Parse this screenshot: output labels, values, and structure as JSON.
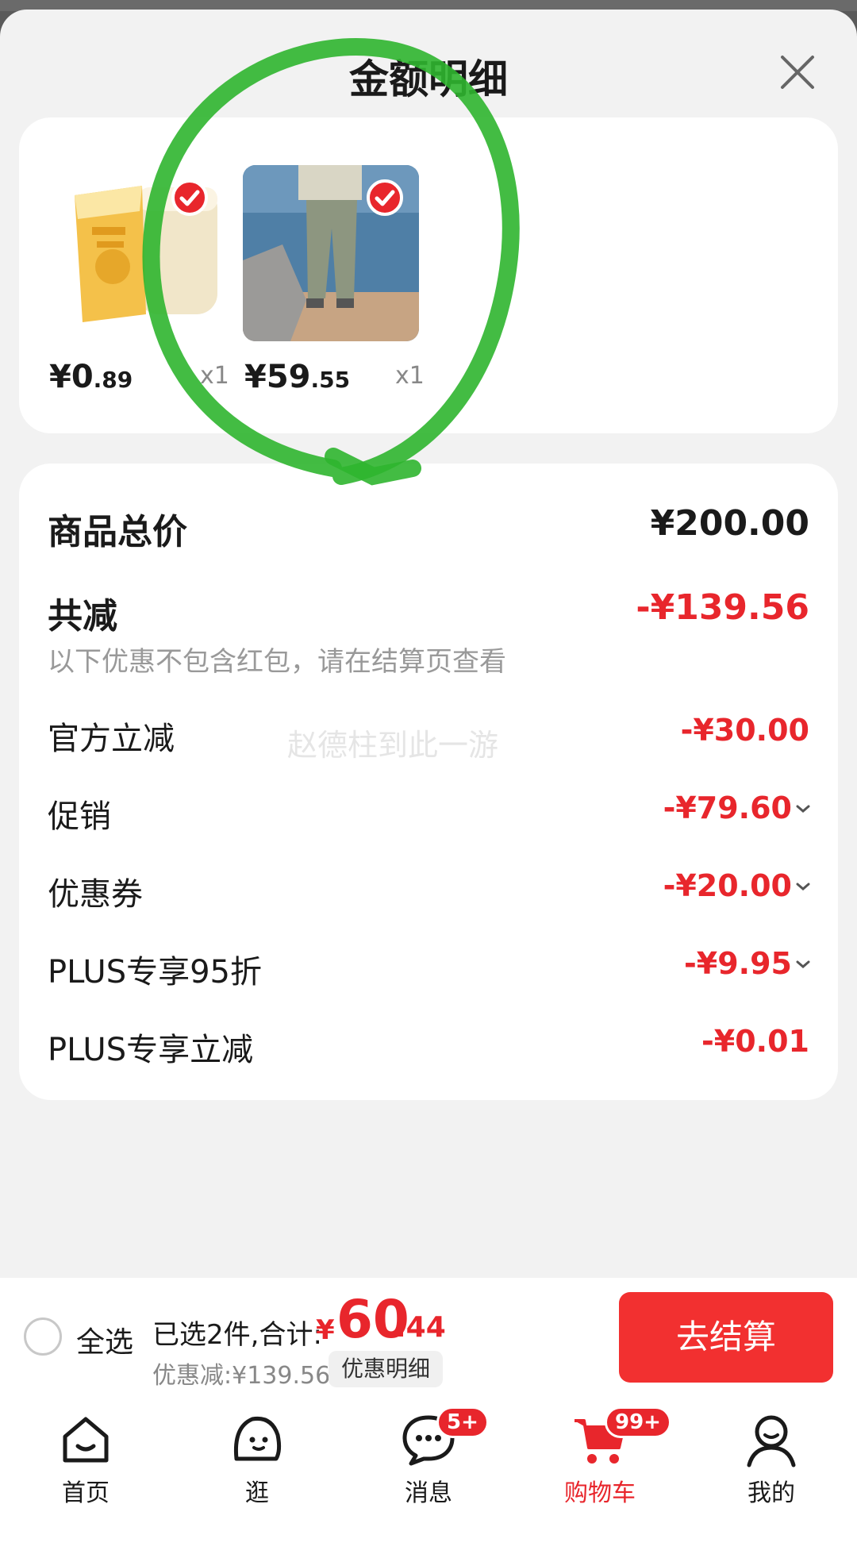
{
  "header": {
    "title": "金额明细",
    "close_icon": "close-icon"
  },
  "products": [
    {
      "price_int": "¥0",
      "price_dec": ".89",
      "qty": "x1",
      "checked": true,
      "image": "milk-tea-bottle"
    },
    {
      "price_int": "¥59",
      "price_dec": ".55",
      "qty": "x1",
      "checked": true,
      "image": "pants-model-seaside"
    }
  ],
  "summary": {
    "total_label": "商品总价",
    "total_value": "¥200.00",
    "reduce_label": "共减",
    "reduce_value": "-¥139.56",
    "hint": "以下优惠不包含红包，请在结算页查看",
    "watermark": "赵德柱到此一游",
    "rows": [
      {
        "label": "官方立减",
        "value": "-¥30.00",
        "expandable": false
      },
      {
        "label": "促销",
        "value": "-¥79.60",
        "expandable": true
      },
      {
        "label": "优惠券",
        "value": "-¥20.00",
        "expandable": true
      },
      {
        "label": "PLUS专享95折",
        "value": "-¥9.95",
        "expandable": true
      },
      {
        "label": "PLUS专享立减",
        "value": "-¥0.01",
        "expandable": false
      }
    ]
  },
  "checkout": {
    "select_all": "全选",
    "selected_text": "已选2件,合计:",
    "currency": "¥",
    "total_int": "60",
    "total_dec": ".44",
    "saved": "优惠减:¥139.56",
    "detail_button": "优惠明细",
    "pay_button": "去结算"
  },
  "tabbar": [
    {
      "label": "首页",
      "icon": "home-icon",
      "active": false
    },
    {
      "label": "逛",
      "icon": "browse-face-icon",
      "active": false
    },
    {
      "label": "消息",
      "icon": "message-icon",
      "active": false,
      "badge": "5+"
    },
    {
      "label": "购物车",
      "icon": "cart-icon",
      "active": true,
      "badge": "99+"
    },
    {
      "label": "我的",
      "icon": "profile-icon",
      "active": false
    }
  ],
  "colors": {
    "accent_red": "#e8262c",
    "highlight_circle": "#2fb52f"
  }
}
